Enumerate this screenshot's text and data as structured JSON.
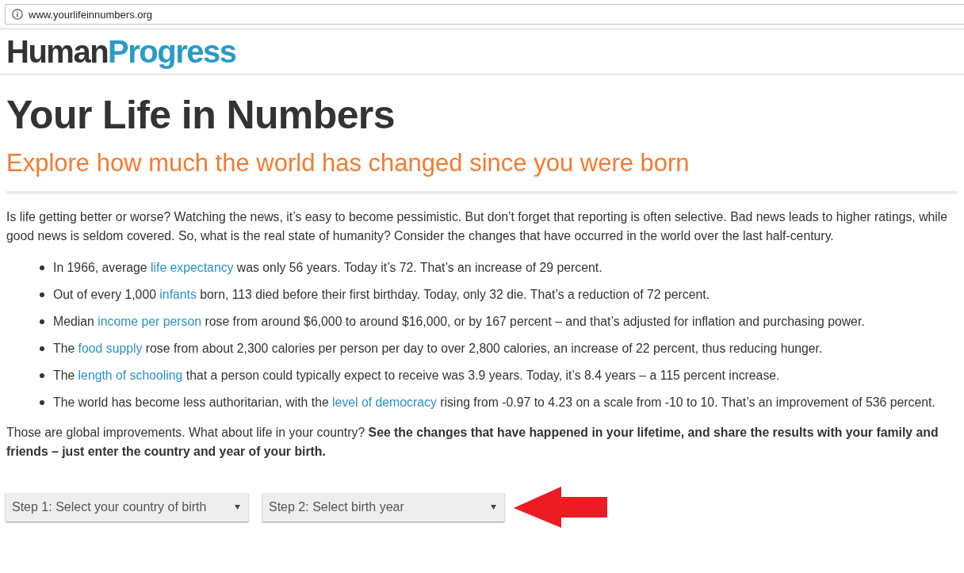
{
  "browser": {
    "url": "www.yourlifeinnumbers.org"
  },
  "header": {
    "logo": [
      {
        "text": "Human",
        "color": "#333333"
      },
      {
        "text": "Progress",
        "color": "#2a9bc6"
      }
    ]
  },
  "title": "Your Life in Numbers",
  "subtitle": "Explore how much the world has changed since you were born",
  "intro": "Is life getting better or worse? Watching the news, it’s easy to become pessimistic. But don’t forget that reporting is often selective. Bad news leads to higher ratings, while good news is seldom covered. So, what is the real state of humanity? Consider the changes that have occurred in the world over the last half-century.",
  "facts": [
    {
      "text_before": "In 1966, average ",
      "link": "life expectancy",
      "text_after": " was only 56 years. Today it’s 72. That’s an increase of 29 percent."
    },
    {
      "text_before": "Out of every 1,000 ",
      "link": "infants",
      "text_after": " born, 113 died before their first birthday. Today, only 32 die. That’s a reduction of 72 percent."
    },
    {
      "text_before": "Median ",
      "link": "income per person",
      "text_after": " rose from around $6,000 to around $16,000, or by 167 percent – and that’s adjusted for inflation and purchasing power."
    },
    {
      "text_before": "The ",
      "link": "food supply",
      "text_after": " rose from about 2,300 calories per person per day to over 2,800 calories, an increase of 22 percent, thus reducing hunger."
    },
    {
      "text_before": "The ",
      "link": "length of schooling",
      "text_after": " that a person could typically expect to receive was 3.9 years. Today, it’s 8.4 years – a 115 percent increase."
    },
    {
      "text_before": "The world has become less authoritarian, with the ",
      "link": "level of democracy",
      "text_after": " rising from -0.97 to 4.23 on a scale from -10 to 10. That’s an improvement of 536 percent."
    }
  ],
  "closing": "Those are global improvements. What about life in your country? **See the changes that have happened in your lifetime, and share the results with your family and friends – just enter the country and year of your birth.**",
  "selects": [
    {
      "label": "Step 1: Select your country of birth"
    },
    {
      "label": "Step 2: Select birth year"
    }
  ]
}
